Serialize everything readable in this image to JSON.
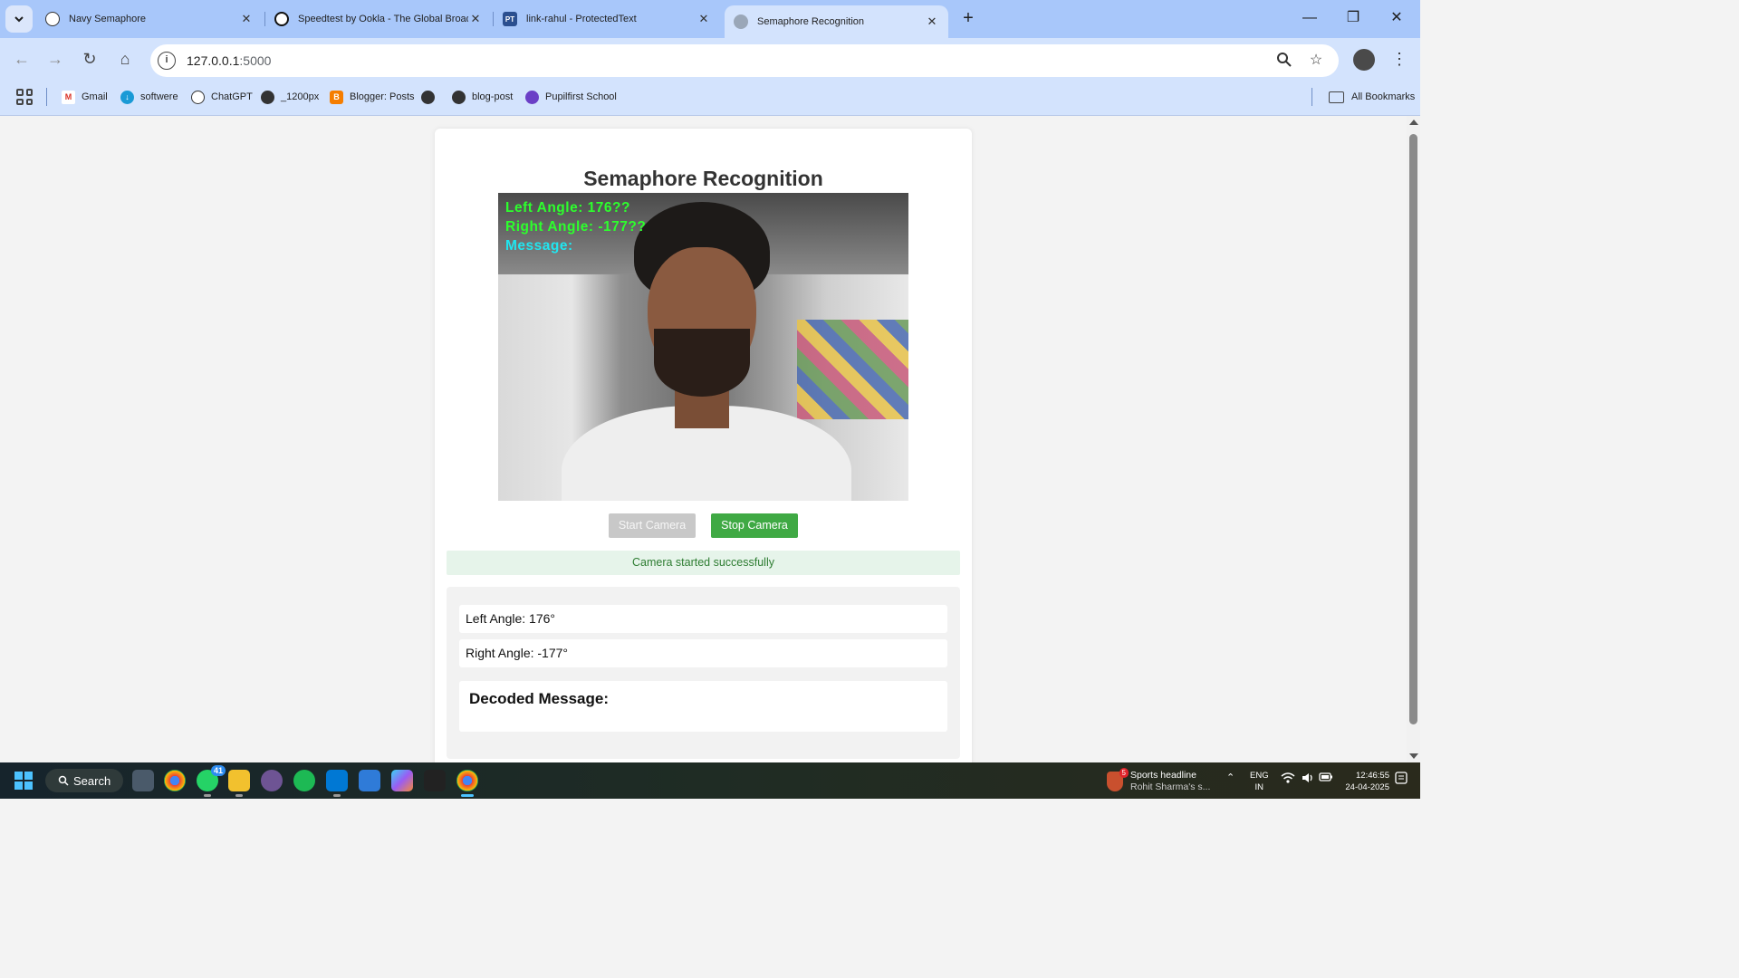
{
  "browser": {
    "tabs": [
      {
        "title": "Navy Semaphore",
        "favicon": "openai-icon"
      },
      {
        "title": "Speedtest by Ookla - The Global Broadband",
        "favicon": "speedtest-icon"
      },
      {
        "title": "link-rahul - ProtectedText",
        "favicon": "pt-icon",
        "favicon_text": "PT"
      },
      {
        "title": "Semaphore Recognition",
        "favicon": "globe-icon",
        "active": true
      }
    ],
    "url_host": "127.0.0.1",
    "url_port": ":5000",
    "bookmarks": [
      {
        "label": "Gmail",
        "icon": "gmail-icon"
      },
      {
        "label": "softwere",
        "icon": "download-icon"
      },
      {
        "label": "ChatGPT",
        "icon": "openai-icon"
      },
      {
        "label": "_1200px",
        "icon": "globe-icon"
      },
      {
        "label": "Blogger: Posts",
        "icon": "blogger-icon",
        "icon_text": "B"
      },
      {
        "label": "",
        "icon": "globe-icon"
      },
      {
        "label": "blog-post",
        "icon": "globe-icon"
      },
      {
        "label": "Pupilfirst School",
        "icon": "pupilfirst-icon"
      }
    ],
    "all_bookmarks": "All Bookmarks"
  },
  "page": {
    "title": "Semaphore Recognition",
    "video_overlay": {
      "left_angle": "Left Angle: 176??",
      "right_angle": "Right Angle: -177??",
      "message": "Message:"
    },
    "start_button": "Start Camera",
    "stop_button": "Stop Camera",
    "status": "Camera started successfully",
    "left_angle": "Left Angle: 176°",
    "right_angle": "Right Angle: -177°",
    "decoded_heading": "Decoded Message:",
    "decoded_value": ""
  },
  "taskbar": {
    "search_label": "Search",
    "whatsapp_badge": "41",
    "news_title": "Sports headline",
    "news_subtitle": "Rohit Sharma's s...",
    "news_badge": "5",
    "lang_top": "ENG",
    "lang_bottom": "IN",
    "time": "12:46:55",
    "date": "24-04-2025"
  },
  "colors": {
    "stop_button": "#3fa944",
    "status_bg": "#e6f4ea",
    "status_text": "#2e7d32",
    "overlay_green": "#2dff2d",
    "overlay_cyan": "#20e6f0"
  }
}
